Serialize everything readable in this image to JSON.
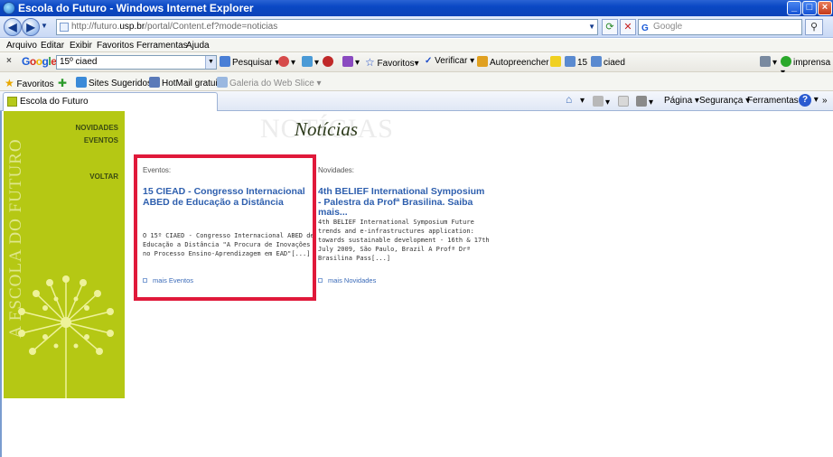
{
  "window": {
    "title": "Escola do Futuro - Windows Internet Explorer",
    "buttons": [
      "_",
      "□",
      "×"
    ]
  },
  "address": {
    "prefix": "http://futuro.",
    "host": "usp.br",
    "path": "/portal/Content.ef?mode=noticias",
    "search_placeholder": "Google"
  },
  "menu": [
    "Arquivo",
    "Editar",
    "Exibir",
    "Favoritos",
    "Ferramentas",
    "Ajuda"
  ],
  "google_toolbar": {
    "logo": "Google",
    "query": "15º ciaed",
    "pesquisar": "Pesquisar",
    "favoritos": "Favoritos",
    "verificar": "Verificar",
    "autopreencher": "Autopreencher",
    "term1": "15",
    "term2": "ciaed",
    "imprensa": "imprensa"
  },
  "links_bar": {
    "favoritos": "Favoritos",
    "sites_sugeridos": "Sites Sugeridos",
    "hotmail": "HotMail gratuito",
    "galeria": "Galeria do Web Slice"
  },
  "tab": {
    "title": "Escola do Futuro"
  },
  "command_bar": {
    "pagina": "Página",
    "seguranca": "Segurança",
    "ferramentas": "Ferramentas"
  },
  "sidebar": {
    "vertical_title": "A ESCOLA DO FUTURO",
    "links": [
      "NOVIDADES",
      "EVENTOS",
      "VOLTAR"
    ]
  },
  "content": {
    "watermark": "NOTÍCIAS",
    "heading": "Notícias",
    "eventos": {
      "label": "Eventos:",
      "title": "15 CIEAD - Congresso Internacional ABED de Educação a Distância",
      "body": "O 15º CIAED - Congresso Internacional ABED de Educação a Distância \"A Procura de Inovações no Processo Ensino-Aprendizagem em EAD\"[...]",
      "more": "mais Eventos"
    },
    "novidades": {
      "label": "Novidades:",
      "title": "4th BELIEF International Symposium - Palestra da Profª Brasilina. Saiba mais...",
      "body": "4th BELIEF International Symposium Future trends and e-infrastructures application: towards sustainable development - 16th & 17th July 2009, São Paulo, Brazil A Profª Drª Brasilina Pass[...]",
      "more": "mais Novidades"
    }
  },
  "colors": {
    "sidebar": "#b5c814",
    "highlight": "#e0193a",
    "link": "#2e5fae"
  }
}
